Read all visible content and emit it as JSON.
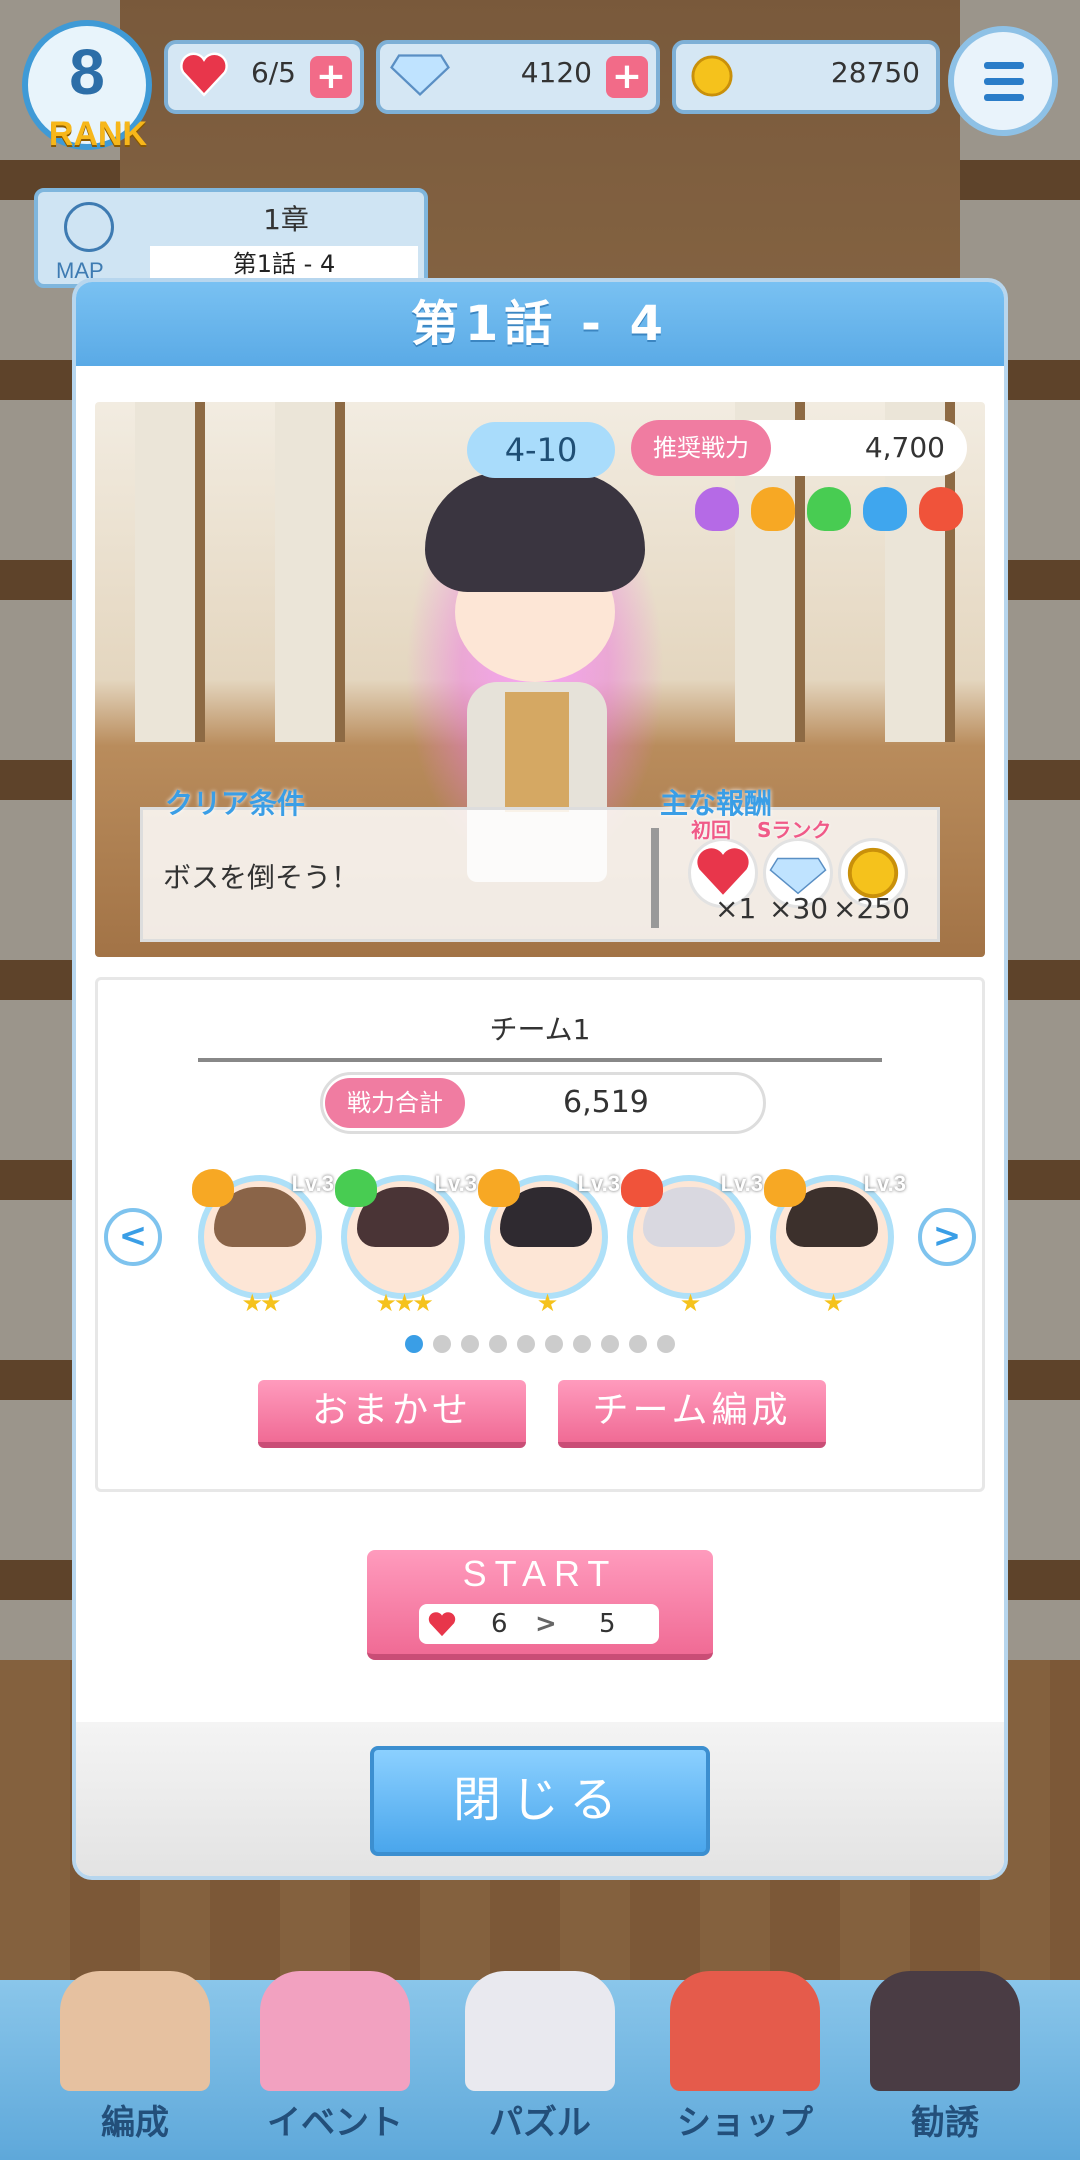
{
  "top": {
    "rank_number": "8",
    "rank_label": "RANK",
    "hearts": "6/5",
    "gems": "4120",
    "coins": "28750"
  },
  "map": {
    "chapter": "1章",
    "episode": "第1話 - 4",
    "map_label": "MAP"
  },
  "modal": {
    "title": "第1話 - 4",
    "stage_number": "4-10",
    "recommended_power_label": "推奨戦力",
    "recommended_power_value": "4,700",
    "attributes": [
      "purple-icon",
      "orange-icon",
      "green-icon",
      "blue-icon",
      "red-icon"
    ],
    "clear_condition_title": "クリア条件",
    "clear_condition_text": "ボスを倒そう！",
    "rewards_title": "主な報酬",
    "rewards": [
      {
        "tag": "初回",
        "icon": "heart-icon",
        "count": "×1"
      },
      {
        "tag": "Sランク",
        "icon": "gem-icon",
        "count": "×30"
      },
      {
        "tag": "",
        "icon": "coin-icon",
        "count": "×250"
      }
    ],
    "team_name": "チーム1",
    "team_power_label": "戦力合計",
    "team_power_value": "6,519",
    "members": [
      {
        "level": "Lv.3",
        "stars": "★★",
        "element": "orange",
        "hair": "#8a6448"
      },
      {
        "level": "Lv.3",
        "stars": "★★★",
        "element": "green",
        "hair": "#4a3436"
      },
      {
        "level": "Lv.3",
        "stars": "★",
        "element": "orange",
        "hair": "#2f2a30"
      },
      {
        "level": "Lv.3",
        "stars": "★",
        "element": "red",
        "hair": "#d9d8e0"
      },
      {
        "level": "Lv.3",
        "stars": "★",
        "element": "orange",
        "hair": "#3c302c"
      }
    ],
    "page_count": 10,
    "active_page": 1,
    "auto_button": "おまかせ",
    "team_edit_button": "チーム編成",
    "start_label": "START",
    "start_cost_before": "6",
    "start_cost_after": "5",
    "close_button": "閉じる"
  },
  "bottom_nav": [
    "編成",
    "イベント",
    "パズル",
    "ショップ",
    "勧誘"
  ],
  "colors": {
    "accent_blue": "#3a9ee6",
    "accent_pink": "#f07ca1"
  }
}
